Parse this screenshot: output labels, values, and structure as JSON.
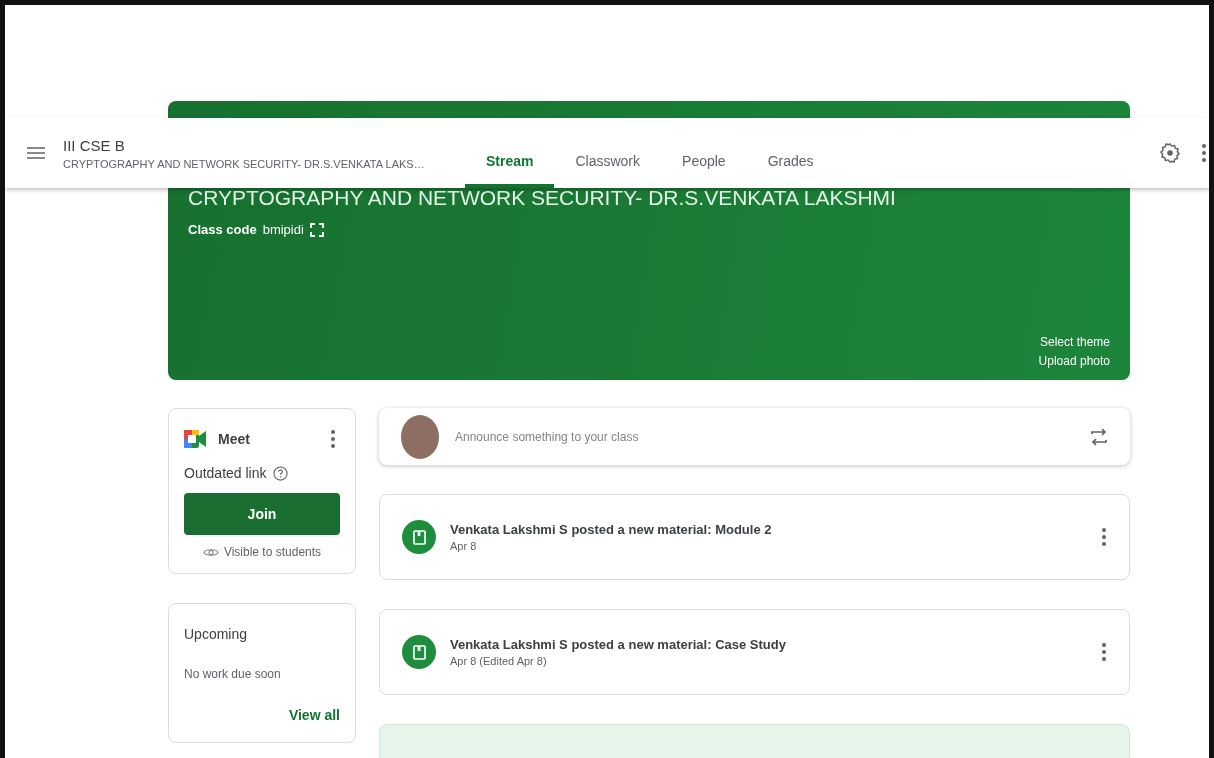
{
  "header": {
    "class_name": "III CSE B",
    "subtitle": "CRYPTOGRAPHY AND NETWORK SECURITY- DR.S.VENKATA LAKS…"
  },
  "tabs": [
    {
      "label": "Stream",
      "selected": true
    },
    {
      "label": "Classwork",
      "selected": false
    },
    {
      "label": "People",
      "selected": false
    },
    {
      "label": "Grades",
      "selected": false
    }
  ],
  "banner": {
    "title": "CRYPTOGRAPHY AND NETWORK SECURITY- DR.S.VENKATA LAKSHMI",
    "class_code_label": "Class code",
    "class_code": "bmipidi",
    "links": [
      "Select theme",
      "Upload photo"
    ]
  },
  "meet": {
    "title": "Meet",
    "status": "Outdated link",
    "button": "Join",
    "visibility": "Visible to students"
  },
  "upcoming": {
    "title": "Upcoming",
    "message": "No work due soon",
    "link": "View all"
  },
  "announce": {
    "placeholder": "Announce something to your class"
  },
  "posts": [
    {
      "title": "Venkata Lakshmi S posted a new material: Module 2",
      "date": "Apr 8"
    },
    {
      "title": "Venkata Lakshmi S posted a new material: Case Study",
      "date": "Apr 8 (Edited Apr 8)"
    }
  ]
}
